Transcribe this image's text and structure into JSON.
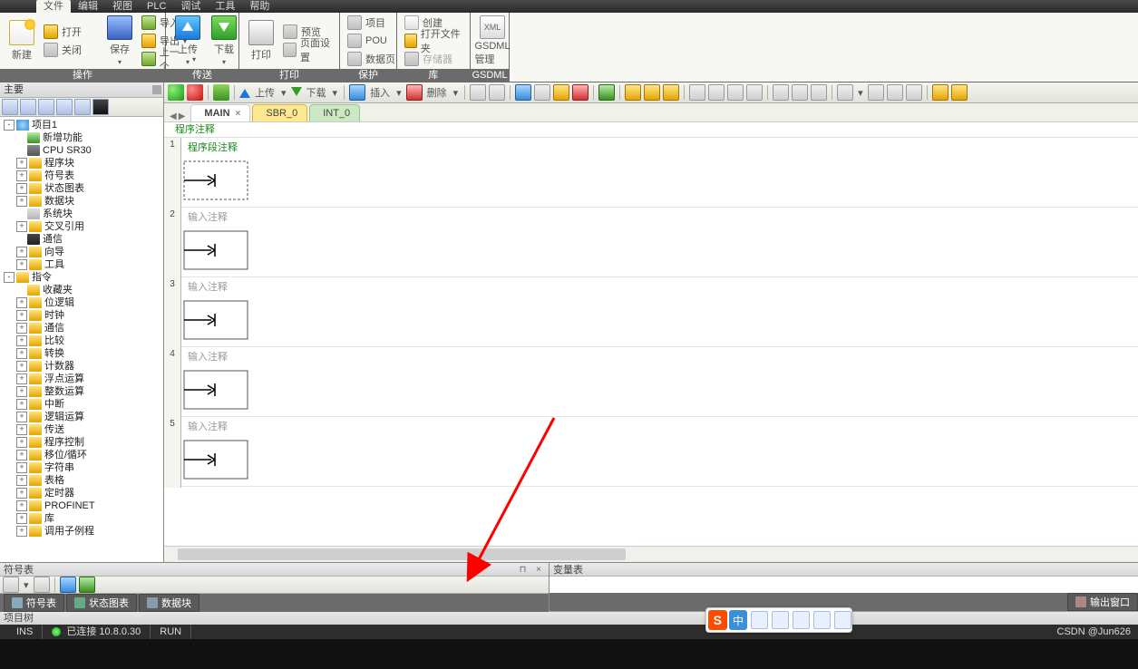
{
  "menu": {
    "file": "文件",
    "edit": "编辑",
    "view": "视图",
    "plc": "PLC",
    "debug": "调试",
    "tools": "工具",
    "help": "帮助"
  },
  "ribbon": {
    "op": {
      "title": "操作",
      "new": "新建",
      "open": "打开",
      "close": "关闭",
      "save": "保存",
      "import": "导入",
      "export": "导出",
      "prev": "上一个"
    },
    "trans": {
      "title": "传送",
      "upload": "上传",
      "download": "下载"
    },
    "print": {
      "title": "打印",
      "print": "打印",
      "preview": "预览",
      "pagesetup": "页面设置"
    },
    "protect": {
      "title": "保护",
      "project": "项目",
      "pou": "POU",
      "datapage": "数据页"
    },
    "lib": {
      "title": "库",
      "create": "创建",
      "openfolder": "打开文件夹",
      "storage": "存储器"
    },
    "gsdml": {
      "title": "GSDML",
      "xml": "XML",
      "manage": "GSDML\n管理"
    }
  },
  "toolbar": {
    "upload": "上传",
    "download": "下载",
    "insert": "插入",
    "delete": "删除"
  },
  "leftpanel": {
    "title": "主要"
  },
  "tree": {
    "root": "项目1",
    "items": [
      {
        "icon": "grn",
        "label": "新增功能",
        "indent": 1,
        "exp": ""
      },
      {
        "icon": "cpu",
        "label": "CPU SR30",
        "indent": 1,
        "exp": ""
      },
      {
        "icon": "fold",
        "label": "程序块",
        "indent": 1,
        "exp": "+"
      },
      {
        "icon": "fold",
        "label": "符号表",
        "indent": 1,
        "exp": "+"
      },
      {
        "icon": "fold",
        "label": "状态图表",
        "indent": 1,
        "exp": "+"
      },
      {
        "icon": "fold",
        "label": "数据块",
        "indent": 1,
        "exp": "+"
      },
      {
        "icon": "gr",
        "label": "系统块",
        "indent": 1,
        "exp": ""
      },
      {
        "icon": "fold",
        "label": "交叉引用",
        "indent": 1,
        "exp": "+"
      },
      {
        "icon": "mon",
        "label": "通信",
        "indent": 1,
        "exp": ""
      },
      {
        "icon": "fold",
        "label": "向导",
        "indent": 1,
        "exp": "+"
      },
      {
        "icon": "fold",
        "label": "工具",
        "indent": 1,
        "exp": "+"
      }
    ],
    "instr_root": "指令",
    "instr": [
      {
        "label": "收藏夹",
        "icon": "fold",
        "exp": ""
      },
      {
        "label": "位逻辑",
        "icon": "fold",
        "exp": "+"
      },
      {
        "label": "时钟",
        "icon": "fold",
        "exp": "+"
      },
      {
        "label": "通信",
        "icon": "fold",
        "exp": "+"
      },
      {
        "label": "比较",
        "icon": "fold",
        "exp": "+"
      },
      {
        "label": "转换",
        "icon": "fold",
        "exp": "+"
      },
      {
        "label": "计数器",
        "icon": "fold",
        "exp": "+"
      },
      {
        "label": "浮点运算",
        "icon": "fold",
        "exp": "+"
      },
      {
        "label": "整数运算",
        "icon": "fold",
        "exp": "+"
      },
      {
        "label": "中断",
        "icon": "fold",
        "exp": "+"
      },
      {
        "label": "逻辑运算",
        "icon": "fold",
        "exp": "+"
      },
      {
        "label": "传送",
        "icon": "fold",
        "exp": "+"
      },
      {
        "label": "程序控制",
        "icon": "fold",
        "exp": "+"
      },
      {
        "label": "移位/循环",
        "icon": "fold",
        "exp": "+"
      },
      {
        "label": "字符串",
        "icon": "fold",
        "exp": "+"
      },
      {
        "label": "表格",
        "icon": "fold",
        "exp": "+"
      },
      {
        "label": "定时器",
        "icon": "fold",
        "exp": "+"
      },
      {
        "label": "PROFINET",
        "icon": "fold",
        "exp": "+"
      },
      {
        "label": "库",
        "icon": "fold",
        "exp": "+"
      },
      {
        "label": "调用子例程",
        "icon": "fold",
        "exp": "+"
      }
    ]
  },
  "tabs": {
    "main": "MAIN",
    "sbr": "SBR_0",
    "intt": "INT_0",
    "close": "×"
  },
  "editor": {
    "prog_comment": "程序注释",
    "rungs": [
      {
        "num": "1",
        "comment": "程序段注释",
        "first": true
      },
      {
        "num": "2",
        "comment": "输入注释"
      },
      {
        "num": "3",
        "comment": "输入注释"
      },
      {
        "num": "4",
        "comment": "输入注释"
      },
      {
        "num": "5",
        "comment": "输入注释"
      }
    ]
  },
  "bottom": {
    "left_title": "符号表",
    "right_title": "变量表",
    "tabs": {
      "a": "符号表",
      "b": "状态图表",
      "c": "数据块"
    },
    "right_output": "输出窗口"
  },
  "status1": "项目树",
  "status2": {
    "ins": "INS",
    "conn": "已连接 10.8.0.30",
    "run": "RUN",
    "csdn": "CSDN @Jun626"
  },
  "sogou": {
    "logo": "S",
    "txt": "中"
  }
}
